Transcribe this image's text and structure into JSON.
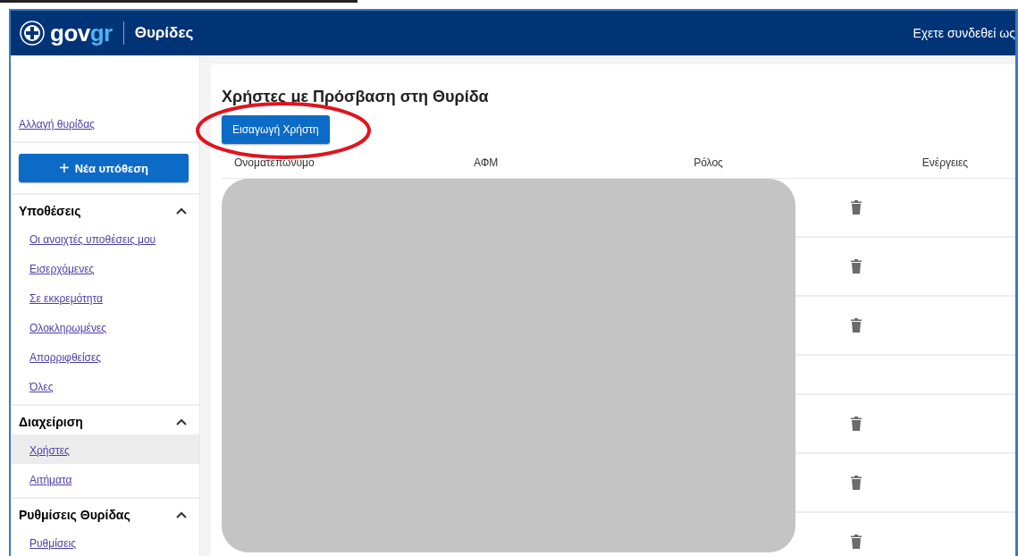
{
  "header": {
    "logo": {
      "part_1": "gov",
      "part_2": "gr"
    },
    "title": "Θυρίδες",
    "user_text": "Εχετε συνδεθεί ως"
  },
  "sidebar": {
    "switch_link": "Αλλαγή θυρίδας",
    "new_case_button": {
      "icon": "+",
      "label": "Νέα υπόθεση"
    },
    "sections": [
      {
        "title": "Υποθέσεις",
        "expanded": true,
        "items": [
          {
            "label": "Οι ανοιχτές υποθέσεις μου",
            "selected": false
          },
          {
            "label": "Εισερχόμενες",
            "selected": false
          },
          {
            "label": "Σε εκκρεμότητα",
            "selected": false
          },
          {
            "label": "Ολοκληρωμένες",
            "selected": false
          },
          {
            "label": "Απορριφθείσες",
            "selected": false
          },
          {
            "label": "Όλες",
            "selected": false
          }
        ]
      },
      {
        "title": "Διαχείριση",
        "expanded": true,
        "items": [
          {
            "label": "Χρήστες",
            "selected": true
          },
          {
            "label": "Αιτήματα",
            "selected": false
          }
        ]
      },
      {
        "title": "Ρυθμίσεις Θυρίδας",
        "expanded": true,
        "items": [
          {
            "label": "Ρυθμίσεις",
            "selected": false
          }
        ]
      }
    ]
  },
  "main": {
    "title": "Χρήστες με Πρόσβαση στη Θυρίδα",
    "add_user_button": "Εισαγωγή Χρήστη",
    "add_button_circled": true,
    "table": {
      "columns": [
        "Ονοματεπώνυμο",
        "ΑΦΜ",
        "Ρόλος",
        "Ενέργειες"
      ],
      "redacted": true,
      "rows": [
        {
          "kind": "full",
          "delete": true
        },
        {
          "kind": "full",
          "delete": true
        },
        {
          "kind": "full",
          "delete": true
        },
        {
          "kind": "short",
          "delete": false
        },
        {
          "kind": "full",
          "delete": true
        },
        {
          "kind": "full",
          "delete": true
        },
        {
          "kind": "full",
          "delete": true
        }
      ]
    }
  }
}
